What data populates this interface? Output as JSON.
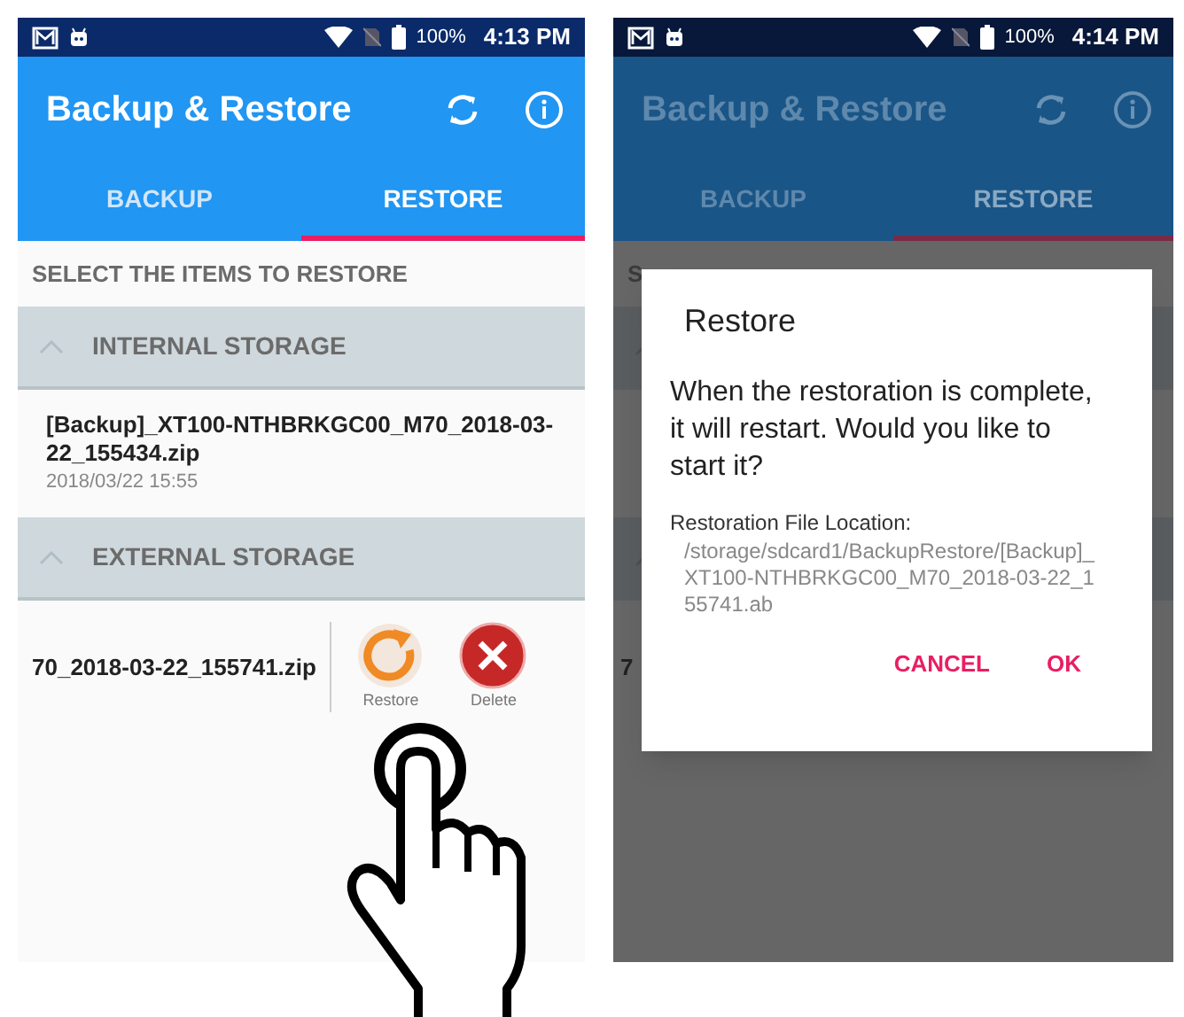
{
  "screens": [
    {
      "dimmed": false,
      "status_bar": {
        "battery": "100%",
        "time": "4:13 PM"
      },
      "app_bar": {
        "title": "Backup & Restore"
      },
      "tabs": [
        {
          "label": "BACKUP",
          "selected": false
        },
        {
          "label": "RESTORE",
          "selected": true
        }
      ],
      "section_heading": "SELECT THE ITEMS TO RESTORE",
      "groups": [
        {
          "title": "INTERNAL STORAGE",
          "expanded": true,
          "items": [
            {
              "name": "[Backup]_XT100-NTHBRKGC00_M70_2018-03-22_155434.zip",
              "date": "2018/03/22 15:55"
            }
          ]
        },
        {
          "title": "EXTERNAL STORAGE",
          "expanded": true,
          "items": [
            {
              "name": "70_2018-03-22_155741.zip",
              "actions": [
                {
                  "kind": "restore",
                  "label": "Restore"
                },
                {
                  "kind": "delete",
                  "label": "Delete"
                }
              ]
            }
          ]
        }
      ]
    },
    {
      "dimmed": true,
      "status_bar": {
        "battery": "100%",
        "time": "4:14 PM"
      },
      "app_bar": {
        "title": "Backup & Restore"
      },
      "tabs": [
        {
          "label": "BACKUP",
          "selected": false
        },
        {
          "label": "RESTORE",
          "selected": true
        }
      ],
      "heading_fragment": "S",
      "row_fragment": "7",
      "dialog": {
        "title": "Restore",
        "message": "When the restoration is complete, it will restart. Would you like to start it?",
        "location_label": "Restoration File Location:",
        "location_path": "/storage/sdcard1/BackupRestore/[Backup]_XT100-NTHBRKGC00_M70_2018-03-22_155741.ab",
        "buttons": [
          "CANCEL",
          "OK"
        ]
      }
    }
  ]
}
